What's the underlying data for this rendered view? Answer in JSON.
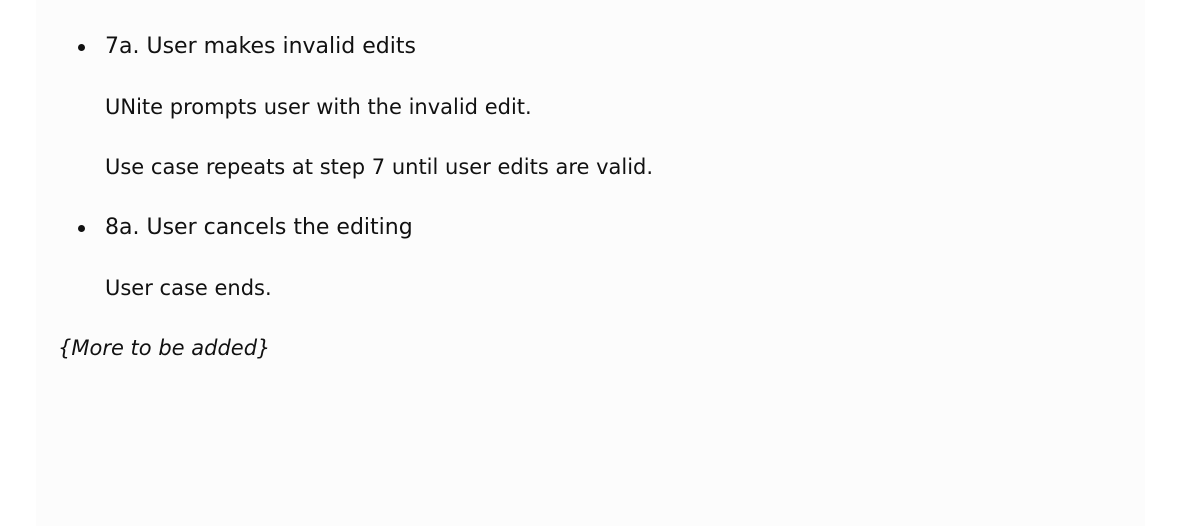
{
  "extensions": [
    {
      "heading": "7a. User makes invalid edits",
      "lines": [
        "UNite prompts user with the invalid edit.",
        "Use case repeats at step 7 until user edits are valid."
      ]
    },
    {
      "heading": "8a. User cancels the editing",
      "lines": [
        "User case ends."
      ]
    }
  ],
  "footer_note": "{More to be added}"
}
